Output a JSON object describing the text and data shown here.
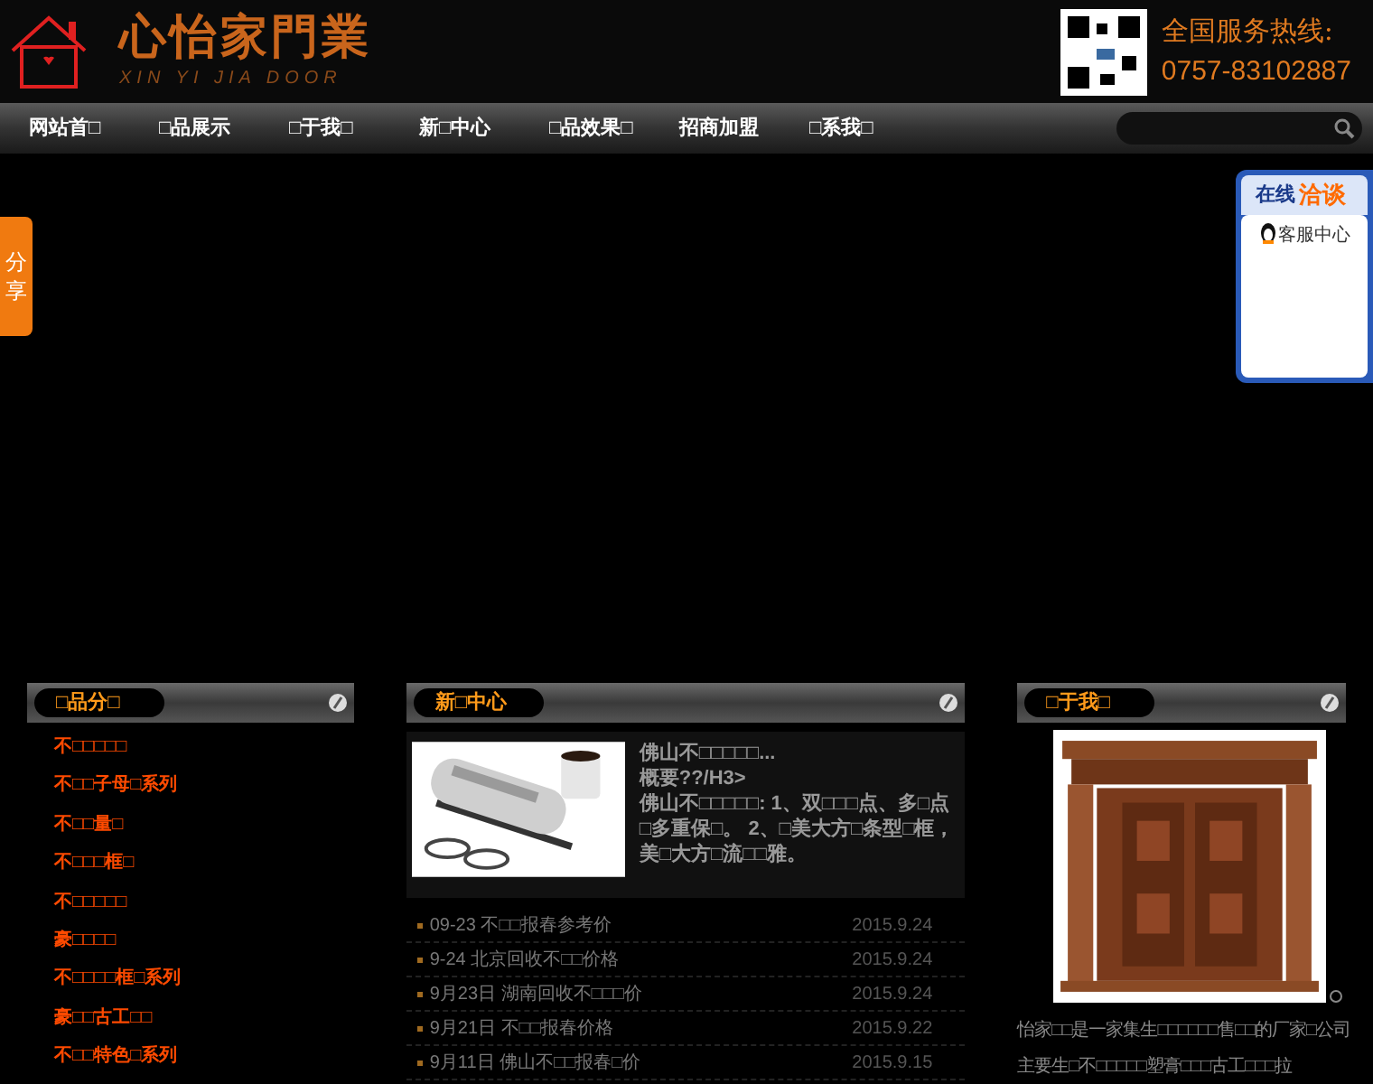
{
  "header": {
    "brand": "心怡家門業",
    "brand_latin": "XIN YI JIA DOOR",
    "hotline_label": "全国服务热线:",
    "hotline": "0757-83102887"
  },
  "nav": [
    "网站首□",
    "□品展示",
    "□于我□",
    "新□中心",
    "□品效果□",
    "招商加盟",
    "□系我□"
  ],
  "share": {
    "label": "分享"
  },
  "chat": {
    "title_a": "在线",
    "title_b": "洽谈",
    "service": "客服中心"
  },
  "categories": {
    "title": "□品分□",
    "items": [
      "不□□□□□",
      "不□□子母□系列",
      "不□□量□",
      "不□□□框□",
      "不□□□□□",
      "豪□□□□",
      "不□□□□框□系列",
      "豪□□古工□□",
      "不□□特色□系列"
    ]
  },
  "news": {
    "title": "新□中心",
    "feature": {
      "title": "佛山不□□□□□...",
      "summary": "概要??/H3>",
      "body": "佛山不□□□□□: 1、双□□□点、多□点□多重保□。 2、□美大方□条型□框，美□大方□流□□雅。"
    },
    "items": [
      {
        "title": "09-23 不□□报春参考价",
        "date": "2015.9.24"
      },
      {
        "title": "9-24 北京回收不□□价格",
        "date": "2015.9.24"
      },
      {
        "title": "9月23日 湖南回收不□□□价",
        "date": "2015.9.24"
      },
      {
        "title": "9月21日 不□□报春价格",
        "date": "2015.9.22"
      },
      {
        "title": "9月11日 佛山不□□报春□价",
        "date": "2015.9.15"
      }
    ]
  },
  "about": {
    "title": "□于我□",
    "text": "怡家□□是一家集生□□□□□□售□□的厂家□公司主要生□不□□□□□塑膏□□□古工□□□拉"
  }
}
